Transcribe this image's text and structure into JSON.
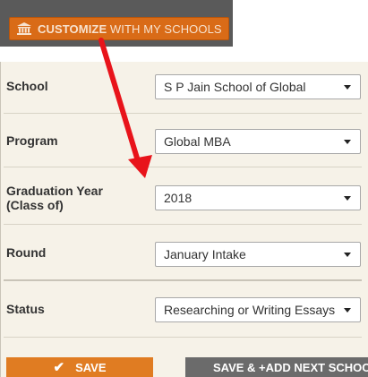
{
  "header": {
    "customize_bold": "CUSTOMIZE",
    "customize_rest": " WITH MY SCHOOLS",
    "icon": "bank-icon"
  },
  "form": {
    "school": {
      "label": "School",
      "value": "S P Jain School of Global"
    },
    "program": {
      "label": "Program",
      "value": "Global MBA"
    },
    "graduation_year": {
      "label_line1": "Graduation Year",
      "label_line2": "(Class of)",
      "value": "2018"
    },
    "round": {
      "label": "Round",
      "value": "January Intake"
    },
    "status": {
      "label": "Status",
      "value": "Researching or Writing Essays"
    }
  },
  "actions": {
    "save_label": "SAVE",
    "save_next_label": "SAVE & +ADD NEXT SCHOOL"
  },
  "colors": {
    "accent_orange": "#e07c22",
    "annotation_arrow": "#e8141b",
    "panel_bg": "#f6f2e8"
  }
}
